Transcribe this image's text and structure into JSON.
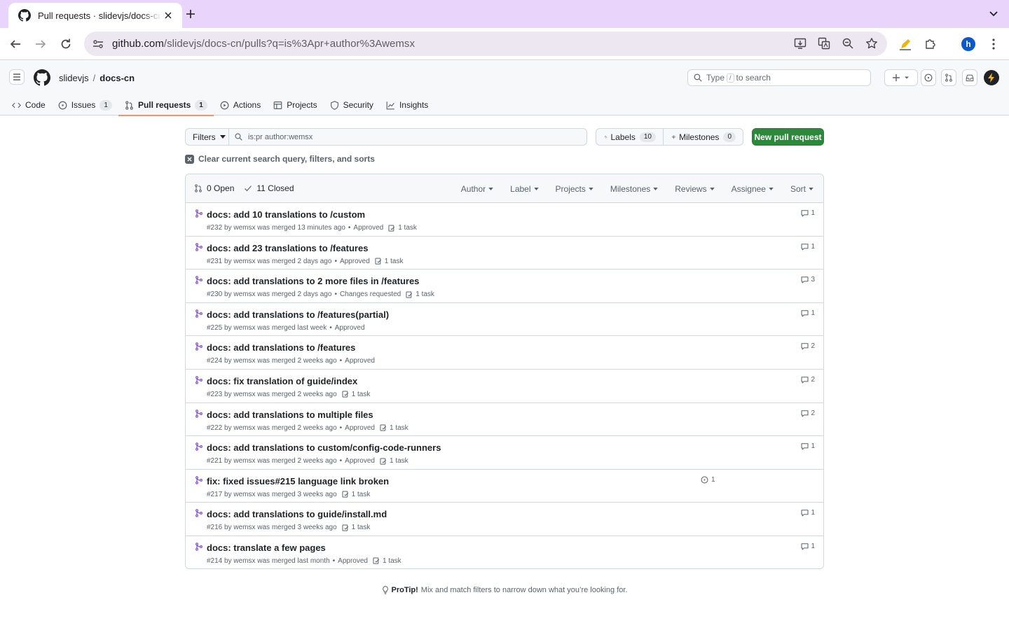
{
  "browser": {
    "tab_title": "Pull requests · slidevjs/docs-cn",
    "url_host": "github.com",
    "url_path": "/slidevjs/docs-cn/pulls?q=is%3Apr+author%3Awemsx",
    "profile_initial": "h"
  },
  "header": {
    "owner": "slidevjs",
    "separator": "/",
    "repo": "docs-cn",
    "search_prefix": "Type",
    "search_key": "/",
    "search_suffix": "to search"
  },
  "repo_nav": [
    {
      "label": "Code",
      "icon": "code-icon"
    },
    {
      "label": "Issues",
      "count": "1",
      "icon": "issue-icon"
    },
    {
      "label": "Pull requests",
      "count": "1",
      "icon": "pull-request-icon",
      "active": true
    },
    {
      "label": "Actions",
      "icon": "play-icon"
    },
    {
      "label": "Projects",
      "icon": "table-icon"
    },
    {
      "label": "Security",
      "icon": "shield-icon"
    },
    {
      "label": "Insights",
      "icon": "graph-icon"
    }
  ],
  "filters": {
    "filters_label": "Filters",
    "query": "is:pr author:wemsx",
    "labels_label": "Labels",
    "labels_count": "10",
    "milestones_label": "Milestones",
    "milestones_count": "0",
    "new_pr_label": "New pull request",
    "clear_label": "Clear current search query, filters, and sorts"
  },
  "list_header": {
    "open_label": "0 Open",
    "closed_label": "11 Closed",
    "sorts": [
      "Author",
      "Label",
      "Projects",
      "Milestones",
      "Reviews",
      "Assignee",
      "Sort"
    ]
  },
  "pulls": [
    {
      "title": "docs: add 10 translations to /custom",
      "number": "#232",
      "merged": "by wemsx was merged 13 minutes ago",
      "review": "Approved",
      "task": "1 task",
      "comments": "1"
    },
    {
      "title": "docs: add 23 translations to /features",
      "number": "#231",
      "merged": "by wemsx was merged 2 days ago",
      "review": "Approved",
      "task": "1 task",
      "comments": "1"
    },
    {
      "title": "docs: add translations to 2 more files in /features",
      "number": "#230",
      "merged": "by wemsx was merged 2 days ago",
      "review": "Changes requested",
      "task": "1 task",
      "comments": "3"
    },
    {
      "title": "docs: add translations to /features(partial)",
      "number": "#225",
      "merged": "by wemsx was merged last week",
      "review": "Approved",
      "task": "",
      "comments": "1"
    },
    {
      "title": "docs: add translations to /features",
      "number": "#224",
      "merged": "by wemsx was merged 2 weeks ago",
      "review": "Approved",
      "task": "",
      "comments": "2"
    },
    {
      "title": "docs: fix translation of guide/index",
      "number": "#223",
      "merged": "by wemsx was merged 2 weeks ago",
      "review": "",
      "task": "1 task",
      "comments": "2"
    },
    {
      "title": "docs: add translations to multiple files",
      "number": "#222",
      "merged": "by wemsx was merged 2 weeks ago",
      "review": "Approved",
      "task": "1 task",
      "comments": "2"
    },
    {
      "title": "docs: add translations to custom/config-code-runners",
      "number": "#221",
      "merged": "by wemsx was merged 2 weeks ago",
      "review": "Approved",
      "task": "1 task",
      "comments": "1"
    },
    {
      "title": "fix: fixed issues#215 language link broken",
      "number": "#217",
      "merged": "by wemsx was merged 3 weeks ago",
      "review": "",
      "task": "1 task",
      "comments": "",
      "linked_issues": "1"
    },
    {
      "title": "docs: add translations to guide/install.md",
      "number": "#216",
      "merged": "by wemsx was merged 3 weeks ago",
      "review": "",
      "task": "1 task",
      "comments": "1"
    },
    {
      "title": "docs: translate a few pages",
      "number": "#214",
      "merged": "by wemsx was merged last month",
      "review": "Approved",
      "task": "1 task",
      "comments": "1"
    }
  ],
  "protip": {
    "label": "ProTip!",
    "text": "Mix and match filters to narrow down what you’re looking for."
  },
  "colors": {
    "merged": "#8250df",
    "primary_button": "#2c883a",
    "active_tab_underline": "#fd8c73",
    "browser_frame": "#e9d5fb"
  }
}
